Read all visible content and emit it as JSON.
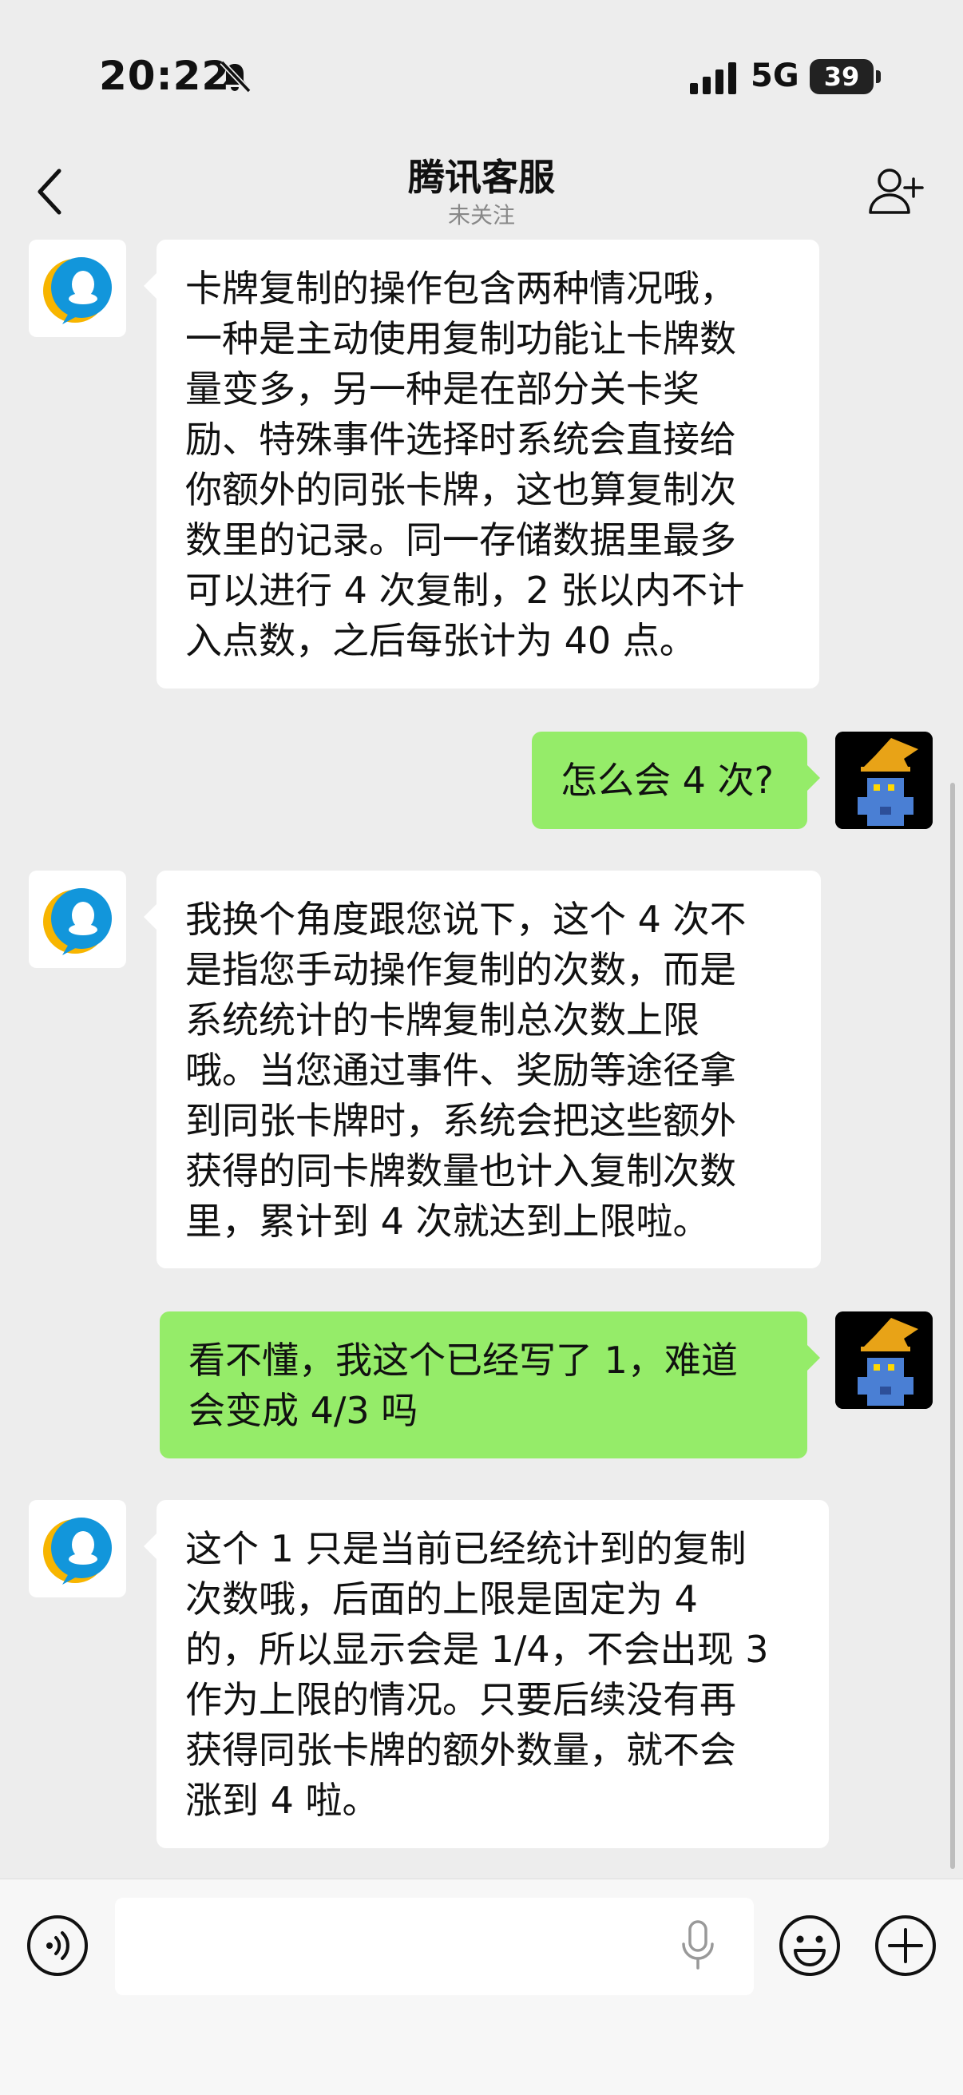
{
  "status_bar": {
    "time": "20:22",
    "network": "5G",
    "battery": "39",
    "icons": [
      "bell-muted-icon",
      "signal-icon"
    ]
  },
  "nav": {
    "title": "腾讯客服",
    "subtitle": "未关注",
    "icons": [
      "back-icon",
      "add-user-icon"
    ]
  },
  "messages": [
    {
      "from": "bot",
      "text": "卡牌复制的操作包含两种情况哦，\n一种是主动使用复制功能让卡牌数\n量变多，另一种是在部分关卡奖\n励、特殊事件选择时系统会直接给\n你额外的同张卡牌，这也算复制次\n数里的记录。同一存储数据里最多\n可以进行 4 次复制，2 张以内不计\n入点数，之后每张计为 40 点。"
    },
    {
      "from": "user",
      "text": "怎么会 4 次?"
    },
    {
      "from": "bot",
      "text": "我换个角度跟您说下，这个 4 次不\n是指您手动操作复制的次数，而是\n系统统计的卡牌复制总次数上限\n哦。当您通过事件、奖励等途径拿\n到同张卡牌时，系统会把这些额外\n获得的同卡牌数量也计入复制次数\n里，累计到 4 次就达到上限啦。"
    },
    {
      "from": "user",
      "text": "看不懂，我这个已经写了 1，难道\n会变成 4/3 吗"
    },
    {
      "from": "bot",
      "text": "这个 1 只是当前已经统计到的复制\n次数哦，后面的上限是固定为 4\n的，所以显示会是 1/4，不会出现 3\n作为上限的情况。只要后续没有再\n获得同张卡牌的额外数量，就不会\n涨到 4 啦。"
    }
  ],
  "input_bar": {
    "placeholder": "",
    "icons": [
      "voice-icon",
      "mic-icon",
      "emoji-icon",
      "plus-icon"
    ]
  },
  "colors": {
    "background": "#ededed",
    "user_bubble": "#95ec69",
    "bot_bubble": "#ffffff"
  }
}
